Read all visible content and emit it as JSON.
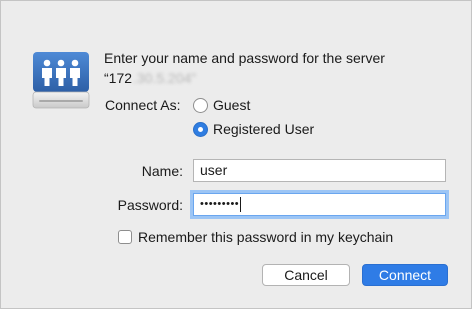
{
  "prompt": {
    "line1": "Enter your name and password for the server",
    "line2_prefix": "“172",
    "line2_obscured": ".30.5.204”"
  },
  "connect_as": {
    "label": "Connect As:",
    "options": [
      {
        "label": "Guest",
        "selected": false
      },
      {
        "label": "Registered User",
        "selected": true
      }
    ]
  },
  "fields": {
    "name_label": "Name:",
    "name_value": "user",
    "password_label": "Password:",
    "password_value": "•••••••••"
  },
  "remember": {
    "label": "Remember this password in my keychain",
    "checked": false
  },
  "buttons": {
    "cancel": "Cancel",
    "connect": "Connect"
  },
  "colors": {
    "accent": "#2f7ce6",
    "dialog_bg": "#ececec",
    "focus_ring": "#9cc5f5"
  },
  "icons": {
    "server": "shared-server-icon",
    "cursor": "text-caret"
  }
}
